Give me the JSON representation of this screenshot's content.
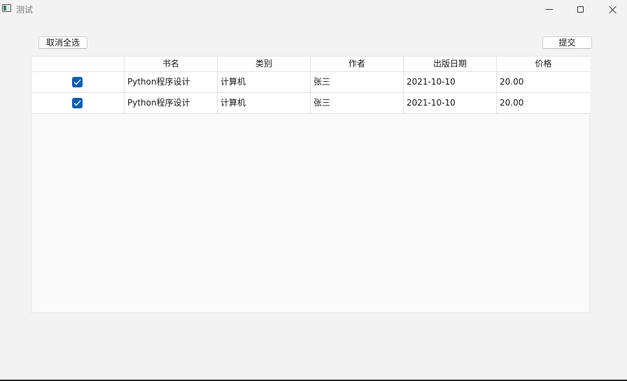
{
  "window": {
    "title": "测试"
  },
  "toolbar": {
    "deselect_all_label": "取消全选",
    "submit_label": "提交"
  },
  "table": {
    "columns": [
      "",
      "书名",
      "类别",
      "作者",
      "出版日期",
      "价格"
    ],
    "rows": [
      {
        "checked": true,
        "title": "Python程序设计",
        "category": "计算机",
        "author": "张三",
        "date": "2021-10-10",
        "price": "20.00"
      },
      {
        "checked": true,
        "title": "Python程序设计",
        "category": "计算机",
        "author": "张三",
        "date": "2021-10-10",
        "price": "20.00"
      }
    ]
  },
  "colors": {
    "checkbox_accent": "#0a5fb4",
    "window_background": "#f3f3f3",
    "table_background": "#fafafa"
  },
  "icons": {
    "app": "app-window-icon",
    "minimize": "minimize-icon",
    "maximize": "maximize-icon",
    "close": "close-icon",
    "check": "checkmark-icon"
  }
}
